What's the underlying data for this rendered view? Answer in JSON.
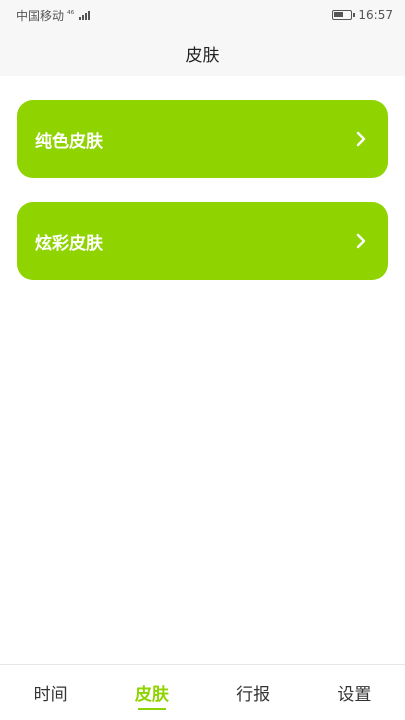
{
  "status_bar": {
    "carrier": "中国移动",
    "network": "⁴⁶",
    "time": "16:57",
    "battery_level": 0.6
  },
  "header": {
    "title": "皮肤"
  },
  "menu": [
    {
      "label": "纯色皮肤"
    },
    {
      "label": "炫彩皮肤"
    }
  ],
  "bottom_nav": [
    {
      "label": "时间"
    },
    {
      "label": "皮肤",
      "active": true
    },
    {
      "label": "行报"
    },
    {
      "label": "设置"
    }
  ],
  "colors": {
    "accent": "#8fd400",
    "header_bg": "#f7f7f7"
  },
  "icons": {
    "menu_chevron": "chevron-right-icon",
    "signal": "signal-icon",
    "battery": "battery-icon"
  }
}
